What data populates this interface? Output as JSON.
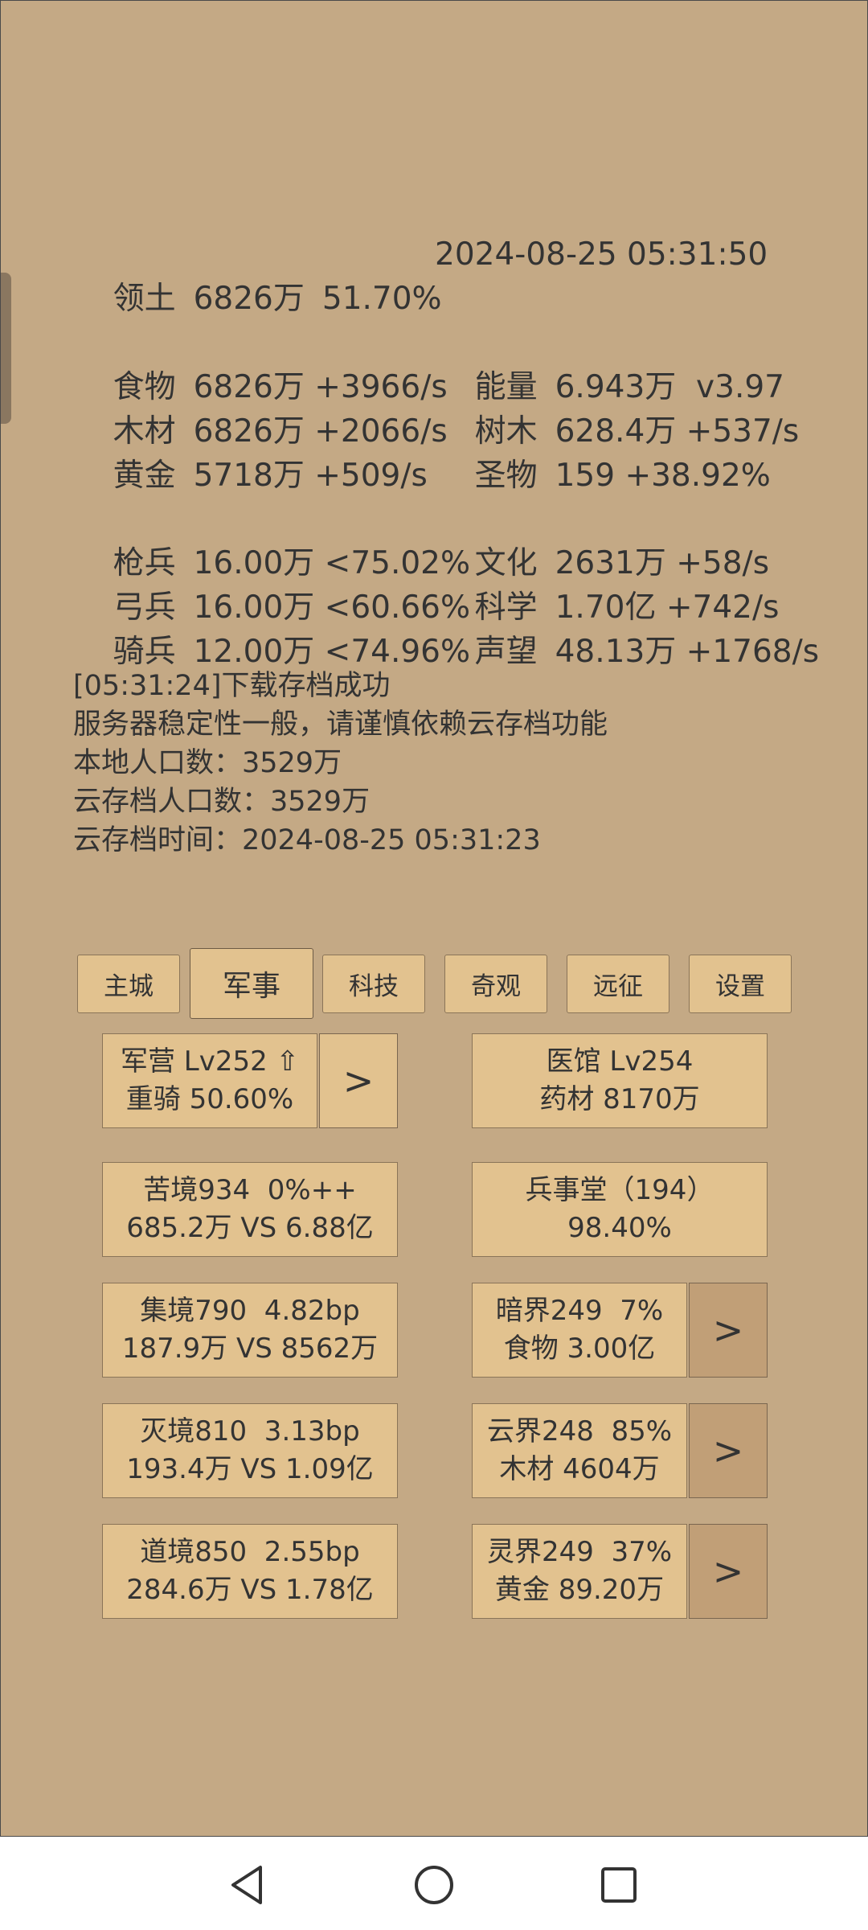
{
  "stats": {
    "territory": {
      "label": "领土",
      "value": "6826万",
      "pct": "51.70%"
    },
    "datetime": "2024-08-25 05:31:50",
    "food": {
      "label": "食物",
      "value": "6826万 +3966/s"
    },
    "energy": {
      "label": "能量",
      "value": "6.943万  v3.97"
    },
    "wood": {
      "label": "木材",
      "value": "6826万 +2066/s"
    },
    "trees": {
      "label": "树木",
      "value": "628.4万 +537/s"
    },
    "gold": {
      "label": "黄金",
      "value": "5718万 +509/s"
    },
    "relics": {
      "label": "圣物",
      "value": "159 +38.92%"
    },
    "spearmen": {
      "label": "枪兵",
      "value": "16.00万 <75.02%"
    },
    "culture": {
      "label": "文化",
      "value": "2631万 +58/s"
    },
    "archers": {
      "label": "弓兵",
      "value": "16.00万 <60.66%"
    },
    "science": {
      "label": "科学",
      "value": "1.70亿 +742/s"
    },
    "cavalry": {
      "label": "骑兵",
      "value": "12.00万 <74.96%"
    },
    "prestige": {
      "label": "声望",
      "value": "48.13万 +1768/s"
    }
  },
  "messages": [
    "[05:31:24]下载存档成功",
    "服务器稳定性一般，请谨慎依赖云存档功能",
    "本地人口数：3529万",
    "云存档人口数：3529万",
    "云存档时间：2024-08-25 05:31:23"
  ],
  "tabs": [
    "主城",
    "军事",
    "科技",
    "奇观",
    "远征",
    "设置"
  ],
  "active_tab": "军事",
  "cards": {
    "barracks": {
      "line1": "军营 Lv252 ⇧",
      "line2": "重骑 50.60%"
    },
    "hospital": {
      "line1": "医馆 Lv254",
      "line2": "药材 8170万"
    },
    "kujing": {
      "line1": "苦境934  0%++",
      "line2": "685.2万 VS 6.88亿"
    },
    "military_hall": {
      "line1": "兵事堂（194）",
      "line2": "98.40%"
    },
    "jijing": {
      "line1": "集境790  4.82bp",
      "line2": "187.9万 VS 8562万"
    },
    "anjie": {
      "line1": "暗界249  7%",
      "line2": "食物 3.00亿"
    },
    "miejing": {
      "line1": "灭境810  3.13bp",
      "line2": "193.4万 VS 1.09亿"
    },
    "yunjie": {
      "line1": "云界248  85%",
      "line2": "木材 4604万"
    },
    "daojing": {
      "line1": "道境850  2.55bp",
      "line2": "284.6万 VS 1.78亿"
    },
    "lingjie": {
      "line1": "灵界249  37%",
      "line2": "黄金 89.20万"
    }
  },
  "arrow_label": ">",
  "colors": {
    "background": "#c4a985",
    "button": "#e2c28f",
    "button_dark": "#c19f77",
    "text": "#333333"
  },
  "nav_icons": [
    "back-triangle-icon",
    "home-circle-icon",
    "recents-square-icon"
  ]
}
